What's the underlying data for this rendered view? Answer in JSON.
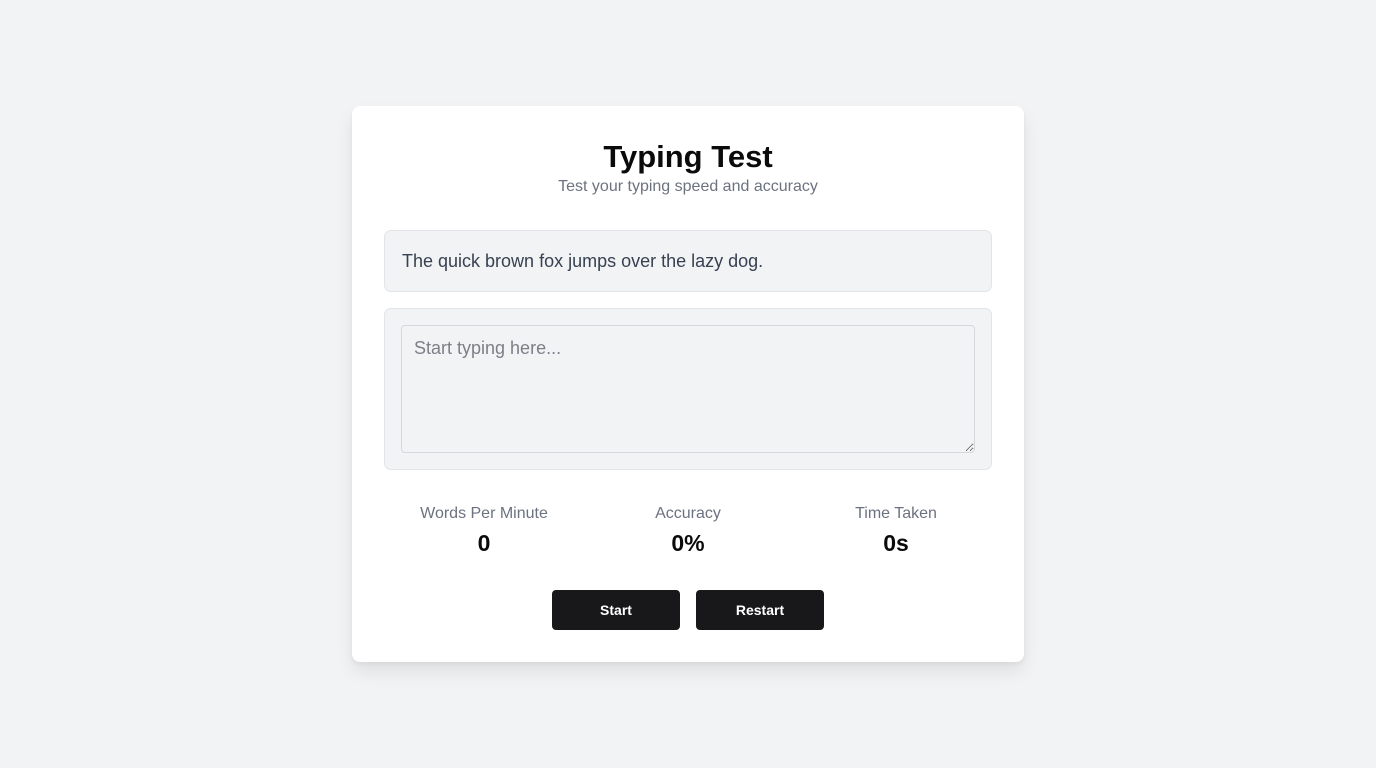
{
  "header": {
    "title": "Typing Test",
    "subtitle": "Test your typing speed and accuracy"
  },
  "sample": {
    "text": "The quick brown fox jumps over the lazy dog."
  },
  "input": {
    "value": "",
    "placeholder": "Start typing here..."
  },
  "stats": {
    "wpm_label": "Words Per Minute",
    "wpm_value": "0",
    "accuracy_label": "Accuracy",
    "accuracy_value": "0%",
    "time_label": "Time Taken",
    "time_value": "0s"
  },
  "buttons": {
    "start_label": "Start",
    "restart_label": "Restart"
  },
  "colors": {
    "background": "#f2f3f5",
    "card": "#ffffff",
    "button": "#18181b",
    "muted_text": "#6b7280"
  }
}
